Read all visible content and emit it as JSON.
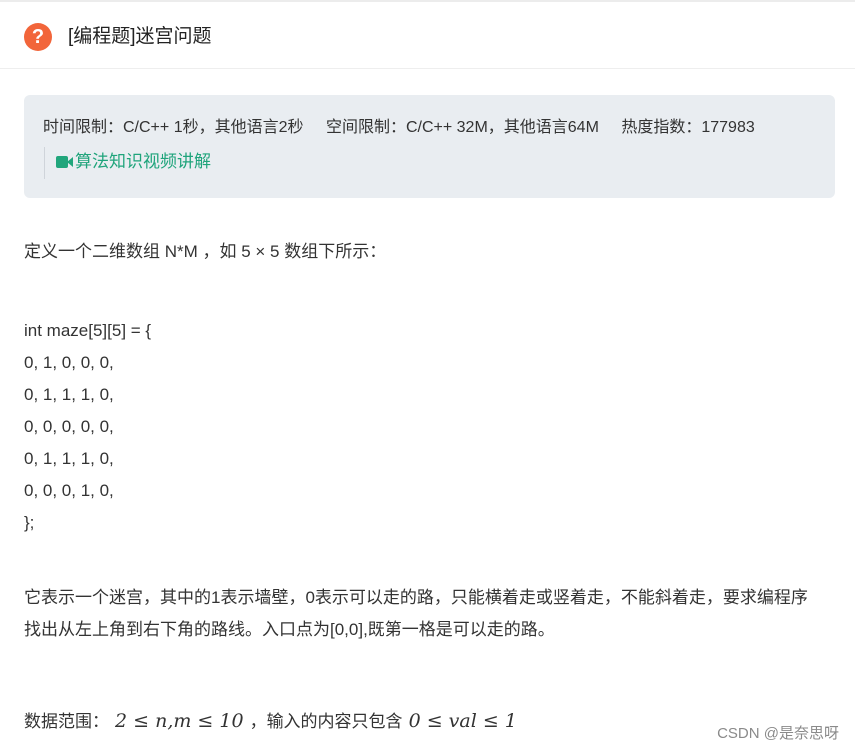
{
  "header": {
    "title": "[编程题]迷宫问题",
    "icon": "question-circle-icon",
    "icon_color": "#f2653a"
  },
  "info": {
    "time_limit": "时间限制：C/C++ 1秒，其他语言2秒",
    "space_limit": "空间限制：C/C++ 32M，其他语言64M",
    "heat_index": "热度指数：177983",
    "video_link": "算法知识视频讲解",
    "video_icon": "video-camera-icon",
    "link_color": "#1fa47b"
  },
  "description": {
    "intro": "定义一个二维数组 N*M ，如 5 × 5 数组下所示：",
    "code_lines": [
      "int maze[5][5] = {",
      "0, 1, 0, 0, 0,",
      "0, 1, 1, 1, 0,",
      "0, 0, 0, 0, 0,",
      "0, 1, 1, 1, 0,",
      "0, 0, 0, 1, 0,",
      "};"
    ],
    "explain_line1": "它表示一个迷宫，其中的1表示墙壁，0表示可以走的路，只能横着走或竖着走，不能斜着走，要求编程序",
    "explain_line2": "找出从左上角到右下角的路线。入口点为[0,0],既第一格是可以走的路。",
    "range_label": "数据范围：",
    "range_expr1": "2 ≤ n,m ≤ 10",
    "range_sep": "，",
    "range_text": "输入的内容只包含",
    "range_expr2": "0 ≤ val ≤ 1"
  },
  "watermark": "CSDN @是奈思呀"
}
